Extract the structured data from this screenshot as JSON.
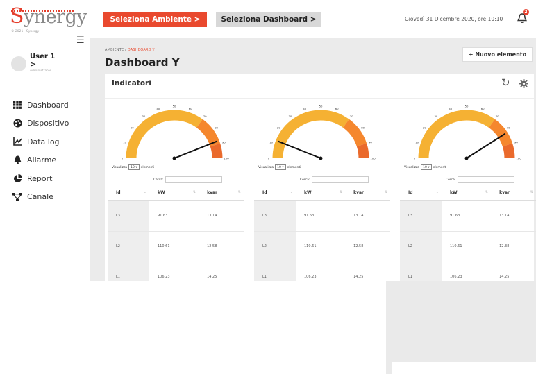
{
  "brand": {
    "logo_text": "ynergy",
    "logo_initial": "S",
    "copyright": "© 2021 - Synergy"
  },
  "user": {
    "name": "User 1",
    "arrow": ">",
    "role": "Administrator"
  },
  "nav": [
    {
      "label": "Dashboard",
      "icon": "grid-icon"
    },
    {
      "label": "Dispositivo",
      "icon": "palette-icon"
    },
    {
      "label": "Data log",
      "icon": "line-chart-icon"
    },
    {
      "label": "Allarme",
      "icon": "bell-icon"
    },
    {
      "label": "Report",
      "icon": "pie-chart-icon"
    },
    {
      "label": "Canale",
      "icon": "network-icon"
    }
  ],
  "topbar": {
    "select_env_label": "Seleziona Ambiente  >",
    "select_dash_label": "Seleziona Dashboard  >",
    "datetime": "Giovedì 31 Dicembre 2020, ore 10:10",
    "notification_count": "2"
  },
  "breadcrumb": {
    "root": "AMBIENTE",
    "sep": " / ",
    "current": "DASHBOARD Y"
  },
  "page_title": "Dashboard Y",
  "new_element_label": "+ Nuovo elemento",
  "panel": {
    "title": "Indicatori"
  },
  "colors": {
    "accent": "#e9492e",
    "gauge_yellow": "#f5b133",
    "gauge_orange": "#f5872e",
    "gauge_red": "#ea6a2c"
  },
  "gauge_ticks": [
    "0",
    "10",
    "20",
    "30",
    "40",
    "50",
    "60",
    "70",
    "80",
    "90",
    "100"
  ],
  "cards": [
    {
      "gauge_value": 88,
      "show_label": "Visualizza",
      "show_value": "10",
      "show_suffix": "elementi",
      "search_label": "Cerca:",
      "columns": [
        "Id",
        "kW",
        "kvar"
      ],
      "rows": [
        {
          "id": "L3",
          "kw": "91.63",
          "kvar": "13.14"
        },
        {
          "id": "L2",
          "kw": "110.61",
          "kvar": "12.58"
        },
        {
          "id": "L1",
          "kw": "106.23",
          "kvar": "14.25"
        }
      ]
    },
    {
      "gauge_value": 12,
      "show_label": "Visualizza",
      "show_value": "10",
      "show_suffix": "elementi",
      "search_label": "Cerca:",
      "columns": [
        "Id",
        "kW",
        "kvar"
      ],
      "rows": [
        {
          "id": "L3",
          "kw": "91.63",
          "kvar": "13.14"
        },
        {
          "id": "L2",
          "kw": "110.61",
          "kvar": "12.58"
        },
        {
          "id": "L1",
          "kw": "106.23",
          "kvar": "14.25"
        }
      ]
    },
    {
      "gauge_value": 82,
      "show_label": "Visualizza",
      "show_value": "10",
      "show_suffix": "elementi",
      "search_label": "Cerca:",
      "columns": [
        "Id",
        "kW",
        "kvar"
      ],
      "rows": [
        {
          "id": "L3",
          "kw": "91.63",
          "kvar": "13.14"
        },
        {
          "id": "L2",
          "kw": "110.61",
          "kvar": "12.38"
        },
        {
          "id": "L1",
          "kw": "106.23",
          "kvar": "14.25"
        }
      ]
    }
  ]
}
